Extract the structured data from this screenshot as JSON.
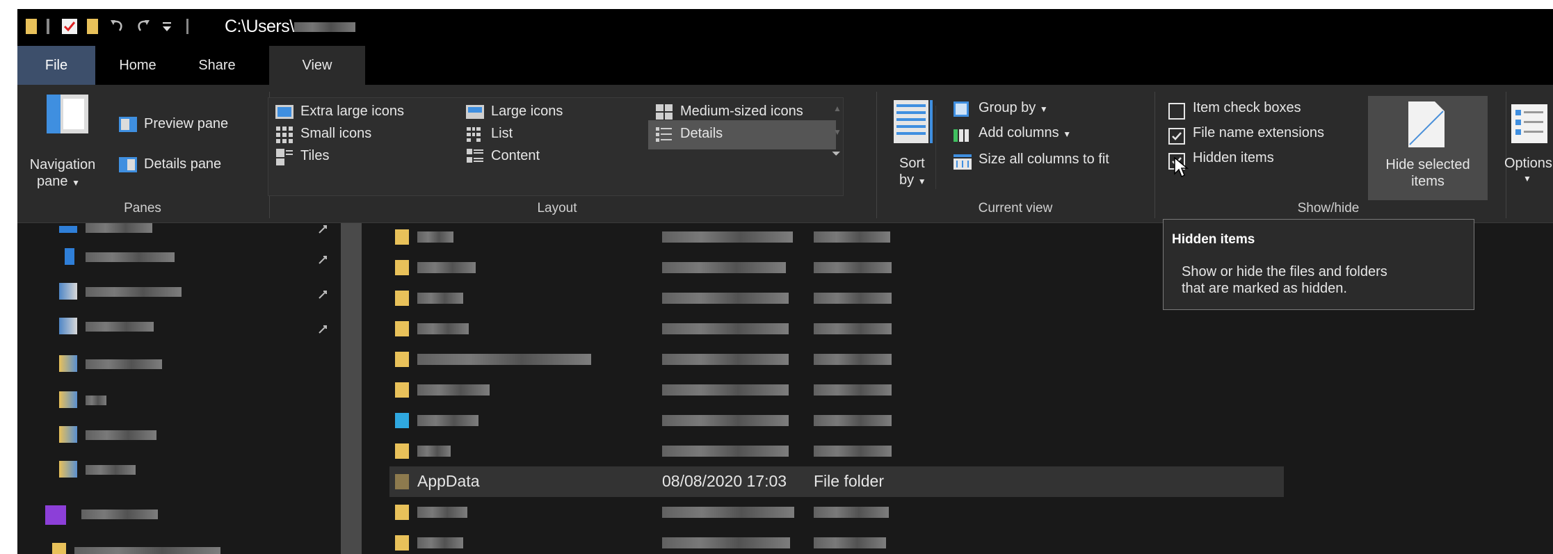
{
  "window": {
    "path": "C:\\Users\\",
    "quick_access_icons": [
      "folder-icon",
      "properties-check-icon",
      "new-folder-icon",
      "undo-icon",
      "redo-icon",
      "customize-dropdown-icon"
    ]
  },
  "tabs": [
    {
      "label": "File",
      "active": false
    },
    {
      "label": "Home",
      "active": false
    },
    {
      "label": "Share",
      "active": false
    },
    {
      "label": "View",
      "active": true
    }
  ],
  "ribbon": {
    "panes": {
      "group_label": "Panes",
      "navigation_pane_line1": "Navigation",
      "navigation_pane_line2": "pane",
      "preview_pane": "Preview pane",
      "details_pane": "Details pane"
    },
    "layout": {
      "group_label": "Layout",
      "options": {
        "extra_large_icons": "Extra large icons",
        "large_icons": "Large icons",
        "medium_icons": "Medium-sized icons",
        "small_icons": "Small icons",
        "list": "List",
        "details": "Details",
        "tiles": "Tiles",
        "content": "Content"
      },
      "selected": "Details"
    },
    "current_view": {
      "group_label": "Current view",
      "sort_line1": "Sort",
      "sort_line2": "by",
      "group_by": "Group by",
      "add_columns": "Add columns",
      "size_columns": "Size all columns to fit"
    },
    "show_hide": {
      "group_label": "Show/hide",
      "item_check_boxes": {
        "label": "Item check boxes",
        "checked": false
      },
      "file_name_extensions": {
        "label": "File name extensions",
        "checked": true
      },
      "hidden_items": {
        "label": "Hidden items",
        "checked": true
      },
      "hide_selected_line1": "Hide selected",
      "hide_selected_line2": "items"
    },
    "options_label": "Options"
  },
  "tooltip": {
    "title": "Hidden items",
    "body_line1": "Show or hide the files and folders",
    "body_line2": "that are marked as hidden."
  },
  "file_list": {
    "appdata": {
      "name": "AppData",
      "date": "08/08/2020 17:03",
      "type": "File folder"
    }
  },
  "colors": {
    "background": "#191919",
    "ribbon": "#2b2b2b",
    "file_tab": "#3d4f6b",
    "selection": "#555555",
    "folder_yellow": "#e8c15a"
  }
}
